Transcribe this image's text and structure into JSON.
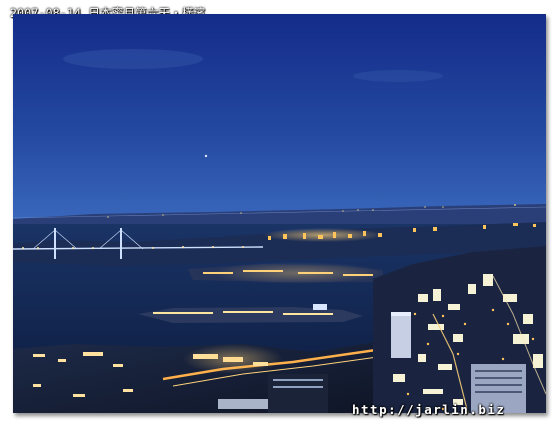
{
  "caption": "2007-08-14  日本蜜月第六天・橫濱",
  "watermark": "http://jarlin.biz",
  "photo": {
    "subject": "Yokohama harbor night view from a high observation deck",
    "colors": {
      "sky_top": "#142c8a",
      "sky_horizon": "#3a68bc",
      "sea": "#10224a",
      "city_lights": "#ffc45a"
    }
  }
}
